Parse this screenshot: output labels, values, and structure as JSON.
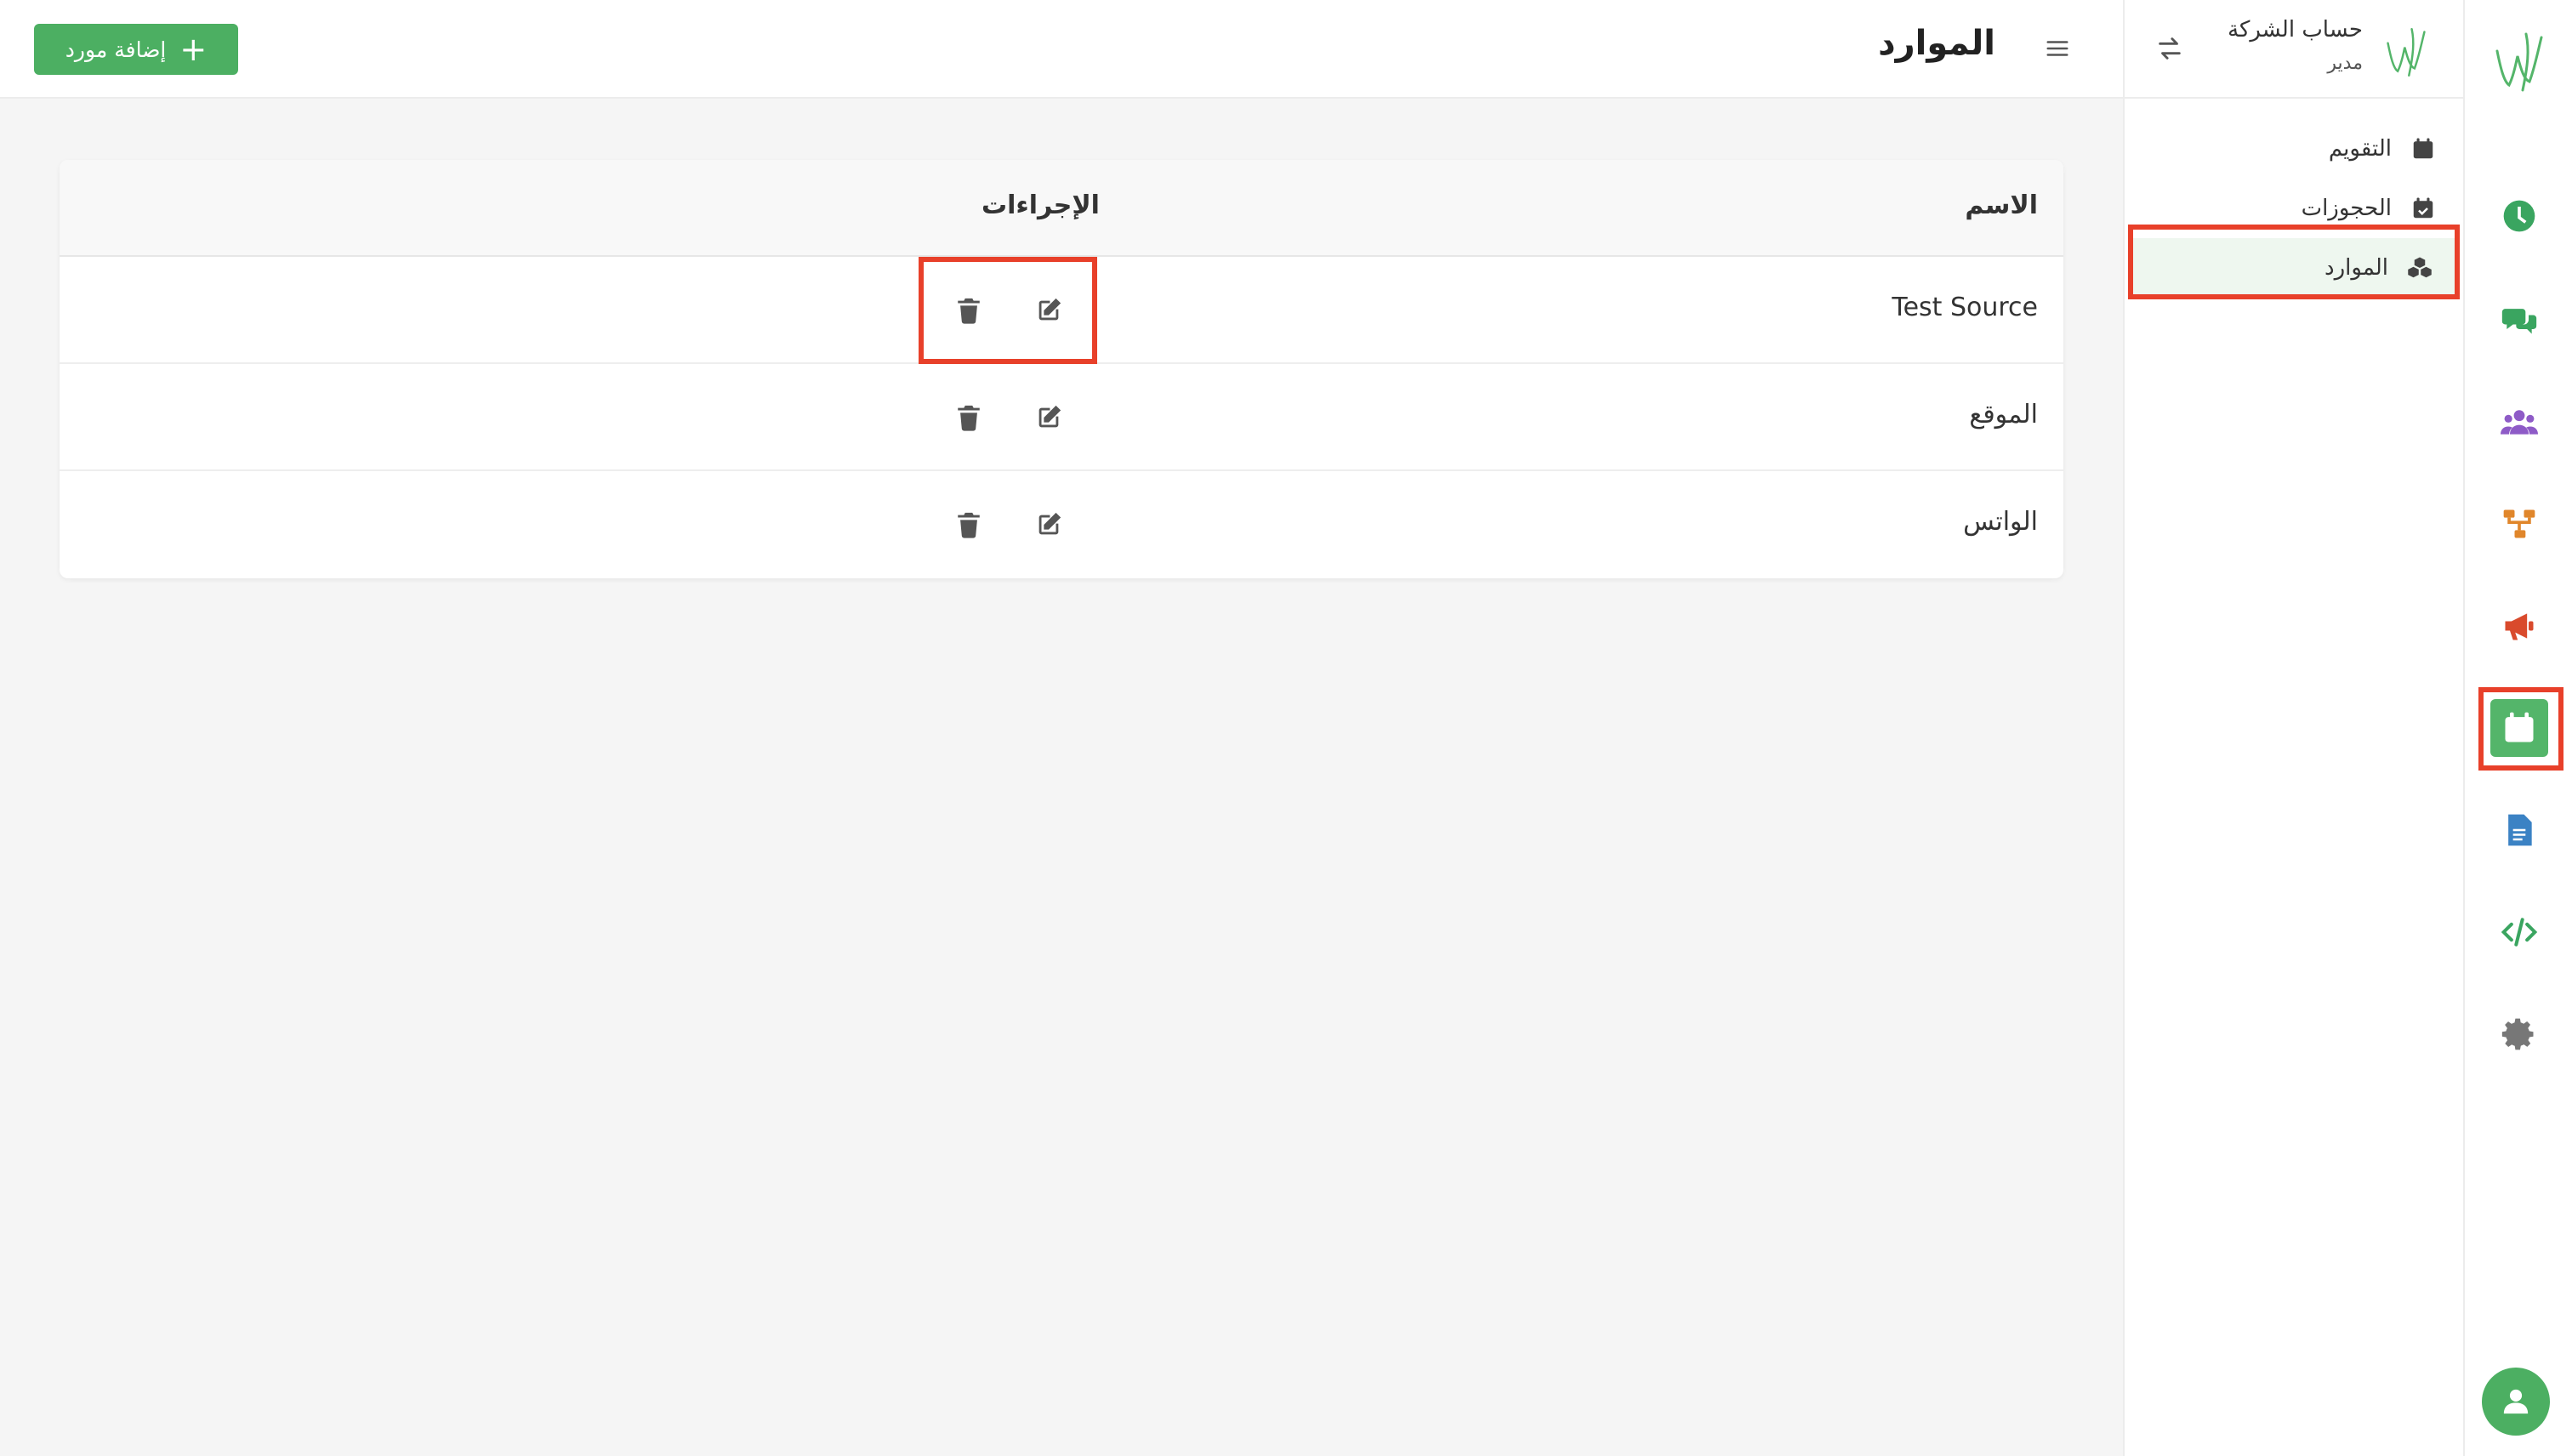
{
  "header": {
    "title": "الموارد",
    "add_button_label": "إضافة مورد",
    "add_button_icon": "plus-icon"
  },
  "account": {
    "name": "حساب الشركة",
    "role": "مدير"
  },
  "sidebar": {
    "items": [
      {
        "label": "التقويم",
        "icon": "calendar-icon",
        "active": false
      },
      {
        "label": "الحجوزات",
        "icon": "calendar-check-icon",
        "active": false
      },
      {
        "label": "الموارد",
        "icon": "cubes-icon",
        "active": true
      }
    ]
  },
  "rail": {
    "items": [
      {
        "icon": "dashboard-icon",
        "color": "#3aa560"
      },
      {
        "icon": "chat-icon",
        "color": "#3aa560"
      },
      {
        "icon": "users-icon",
        "color": "#8e5bc7"
      },
      {
        "icon": "sitemap-icon",
        "color": "#e0862b"
      },
      {
        "icon": "megaphone-icon",
        "color": "#d94a2c"
      },
      {
        "icon": "calendar-icon",
        "color": "#54b56a",
        "active": true
      },
      {
        "icon": "document-icon",
        "color": "#3b82c4"
      },
      {
        "icon": "code-icon",
        "color": "#3aa560"
      },
      {
        "icon": "gear-icon",
        "color": "#777777"
      }
    ]
  },
  "table": {
    "headers": {
      "name": "الاسم",
      "actions": "الإجراءات"
    },
    "rows": [
      {
        "name": "Test Source"
      },
      {
        "name": "الموقع"
      },
      {
        "name": "الواتس"
      }
    ]
  },
  "colors": {
    "accent": "#4caf62",
    "highlight": "#e8402a"
  }
}
